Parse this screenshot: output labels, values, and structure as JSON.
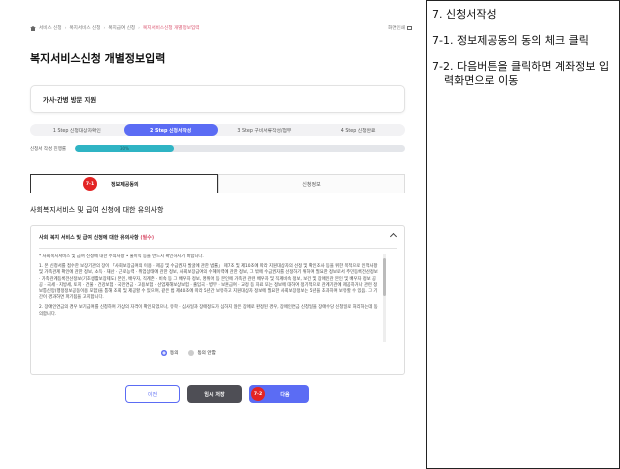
{
  "breadcrumb": {
    "items": [
      "서비스 신청",
      "복지서비스 신청",
      "복지급여 신청",
      "복지서비스신청 개별정보입력"
    ],
    "separator": "›"
  },
  "print": {
    "label": "화면인쇄"
  },
  "page": {
    "title": "복지서비스신청 개별정보입력"
  },
  "service": {
    "name": "가사·간병 방문 지원"
  },
  "steps": [
    {
      "label": "1 Step 신청대상자확인",
      "active": false
    },
    {
      "label": "2 Step 신청서작성",
      "active": true
    },
    {
      "label": "3 Step 구비서류작성/첨부",
      "active": false
    },
    {
      "label": "4 Step 신청완료",
      "active": false
    }
  ],
  "progress": {
    "label": "신청서 작성 진행률",
    "value": 30,
    "text": "30%"
  },
  "tabs": [
    {
      "label": "정보제공동의",
      "badge": "7-1"
    },
    {
      "label": "신청정보"
    }
  ],
  "section": {
    "title": "사회복지서비스 및 급여 신청에 대한 유의사항"
  },
  "notice": {
    "heading": "사회 복지 서비스 및 급여 신청에 대한 유의사항",
    "required": "(필수)",
    "para1": "* 사회복지서비스 및 급여 신청에 대한 주의사항 • 불이익 등을 반드시 확인하시기 바랍니다.",
    "para2": "1. 본 신청서를 접수한 보장기관의 장이 「사회보장급여의 이용 · 제공 및 수급권자 발굴에 관한 법률」 제7조 및 제10조에 따라 지원대상자의 선정 및 확인조사 등을 위한 목적으로 인적사항 및 가족관계 확인에 관한 정보, 소득 · 재산 · 근로능력 · 취업상태에 관한 정보, 사회보장급여의 수혜이력에 관한 정보, 그 밖에 수급권자를 선정하기 위하여 필요한 정보로서 주민등록전산정보 · 가족관계등록전산정보(기초생활보장제도) 본인, 배우자, 직계존 · 비속 등 그 배우자 정보, 명위어 등 본인에 가족관 관련 배우자 및 직계비속 정보, 보건 및 장애인관 본인 및 배우자 정보 공공 · 국세 · 지방세, 토지 · 건물 · 건강보험 · 국민연금 · 고용보험 · 산업재해보상보험 · 출입국 · 병무 · 보훈급여 · 교정 등 자료 또는 정보에 대하여 정기적으로 관계기관에 제공하거나 관련 정보통신망(행정정보공동이용 포함)을 통해 조회 및 제공할 수 있으며, 같은 법 제40조에 따라 5년간 보유하고 지원대상자 정보에 필요한 사회보장정보는 5년을 초과하여 보유할 수 있음. 그 기간이 경과하면 파기됨을 고지합니다.",
    "para3": "2. 장애인연금의 경우 보기급여를 신청하여 가상의 자격이 확인되었으나, 유학 · 심사일과 장애정도가 심하지 않은 장애로 판정된 경우, 장애인연금 신청일을 장애수당 신청일로 처리하는데 동의합니다.",
    "agree": "동의",
    "disagree": "동의 안함"
  },
  "buttons": {
    "prev": "이전",
    "save": "임시 저장",
    "next": "다음",
    "next_badge": "7-2"
  },
  "instructions": {
    "title": "7. 신청서작성",
    "items": [
      "7-1. 정보제공동의 동의 체크 클릭",
      "7-2. 다음버튼을 클릭하면 계좌정보 입력화면으로 이동"
    ]
  },
  "colors": {
    "primary": "#5b6cf4",
    "progress": "#2fb4c4",
    "badge": "#e32424",
    "required": "#d9506b"
  }
}
